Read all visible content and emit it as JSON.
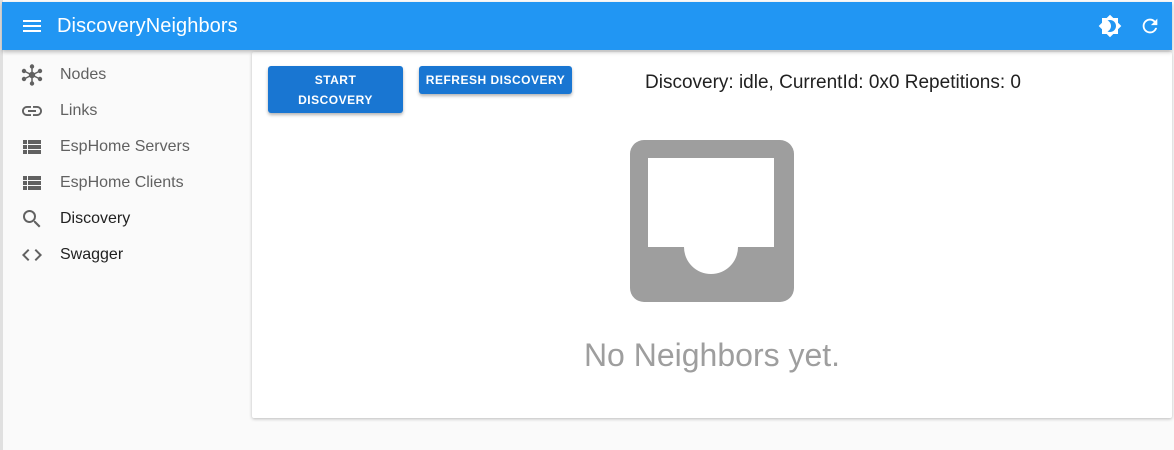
{
  "app": {
    "title": "DiscoveryNeighbors"
  },
  "header": {
    "menu_icon": "menu-icon",
    "theme_icon": "brightness-icon",
    "refresh_icon": "refresh-icon",
    "bar_color": "#2196f3"
  },
  "sidebar": {
    "items": [
      {
        "label": "Nodes",
        "icon": "graph-icon"
      },
      {
        "label": "Links",
        "icon": "link-icon"
      },
      {
        "label": "EspHome Servers",
        "icon": "list-icon"
      },
      {
        "label": "EspHome Clients",
        "icon": "list-icon"
      },
      {
        "label": "Discovery",
        "icon": "search-icon"
      },
      {
        "label": "Swagger",
        "icon": "code-icon"
      }
    ],
    "active": "Discovery"
  },
  "main": {
    "start_button": "START DISCOVERY",
    "refresh_button": "REFRESH DISCOVERY",
    "status": "Discovery: idle, CurrentId: 0x0 Repetitions: 0",
    "empty_icon": "inbox-icon",
    "empty_message": "No Neighbors yet."
  }
}
